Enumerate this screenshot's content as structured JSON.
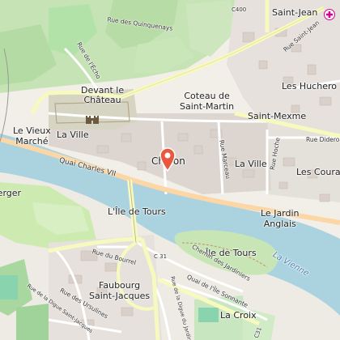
{
  "map": {
    "river_name": "La Vienne",
    "labels": {
      "rue_quinquenays": "Rue des Quinquenays",
      "c400": "C400",
      "saint_jean": "Saint-Jean",
      "rue_saint_jean": "Rue Saint-Jean",
      "rue_echo": "Rue de l'Écho",
      "devant_le_chateau": "Devant le\nChâteau",
      "les_huchereaux": "Les Huchero",
      "coteau_saint_martin": "Coteau de\nSaint-Martin",
      "saint_mexme": "Saint-Mexme",
      "rue_diderot": "Rue Didero",
      "le_vieux_marche": "Le Vieux\nMarché",
      "la_ville_w": "La Ville",
      "quai_charles_vii": "Quai Charles VII",
      "rue_marceau": "Rue Marceau",
      "rue_hoche": "Rue Hoche",
      "la_ville_e": "La Ville",
      "les_courants": "Les Couran",
      "verger": "Verger",
      "ile_de_tours_n": "L'Île de Tours",
      "le_jardin_anglais": "Le Jardin\nAnglais",
      "ile_de_tours_s": "Île de Tours",
      "chemin_des_jardiniers": "Chemin des Jardiniers",
      "rue_du_bourrel": "Rue du Bourrel",
      "c31_w": "C 31",
      "faubourg_saint_jacques": "Faubourg\nSaint-Jacques",
      "rue_ursulines": "Rue des Ursulines",
      "rue_digue_saint_jacques": "Rue de la Digue Saint-Jacques",
      "quai_ile_sonnante": "Quai de l'Île Sonnante",
      "rue_digue_jardiniers": "Rue de la Digue du Jardiniers",
      "la_croix": "La Croix",
      "c31_e": "C31"
    },
    "search_result_label": "Chinon"
  },
  "icons": {
    "marker": "location-pin-icon",
    "castle": "castle-icon",
    "hospital": "hospital-icon"
  },
  "colors": {
    "river": "#aad3df",
    "road_primary": "#fcd6a4",
    "road_secondary": "#f7fabf",
    "forest": "#add19e",
    "vineyard": "#b3e2a8",
    "marker": "#e9573f",
    "hospital": "#da0092"
  }
}
